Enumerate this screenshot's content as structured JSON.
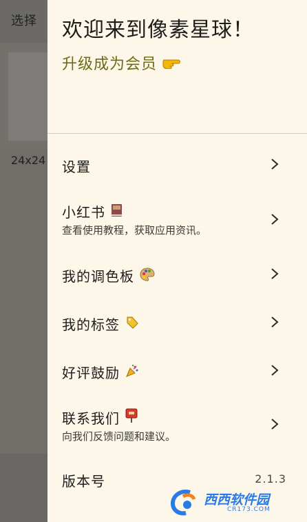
{
  "background": {
    "select_label": "选择",
    "canvas_size": "24x24"
  },
  "drawer": {
    "welcome": "欢迎来到像素星球！",
    "upgrade_label": "升级成为会员",
    "upgrade_icon": "pointing-hand-icon",
    "menu": [
      {
        "title": "设置",
        "icon": "",
        "subtitle": ""
      },
      {
        "title": "小红书",
        "icon": "book-icon",
        "subtitle": "查看使用教程，获取应用资讯。"
      },
      {
        "title": "我的调色板",
        "icon": "palette-icon",
        "subtitle": ""
      },
      {
        "title": "我的标签",
        "icon": "tag-icon",
        "subtitle": ""
      },
      {
        "title": "好评鼓励",
        "icon": "party-popper-icon",
        "subtitle": ""
      },
      {
        "title": "联系我们",
        "icon": "mailbox-icon",
        "subtitle": "向我们反馈问题和建议。"
      }
    ],
    "version": {
      "label": "版本号",
      "value": "2.1.3"
    }
  },
  "watermark": {
    "name": "西西软件园",
    "url": "CR173.COM"
  },
  "colors": {
    "drawer_bg": "#fdf7ea",
    "overlay": "#6f6e69",
    "upgrade_text": "#6f6b14",
    "watermark": "#2a7be6"
  }
}
